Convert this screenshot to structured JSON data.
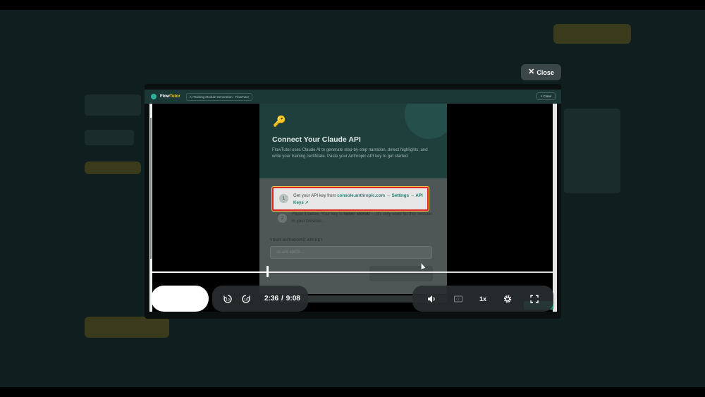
{
  "modal": {
    "close_label": "Close"
  },
  "app": {
    "name_prefix": "Flow",
    "name_suffix": "Tutor",
    "chip": "AI Training Module Generation · FlowTutor",
    "close_label": "× Close"
  },
  "dialog": {
    "title": "Connect Your Claude API",
    "description": "FlowTutor uses Claude AI to generate step-by-step narration, detect highlights, and write your training certificate. Paste your Anthropic API key to get started.",
    "step1": {
      "number": "1",
      "text": "Get your API key from ",
      "link": "console.anthropic.com → Settings → API Keys ↗"
    },
    "step2": {
      "number": "2",
      "text_before": "Paste it below. Your key is ",
      "text_bold": "never stored",
      "text_after": " — it's only used for this session in your browser."
    },
    "field_label": "YOUR ANTHROPIC API KEY",
    "field_placeholder": "sk-ant-api03-..."
  },
  "player": {
    "current_time": "2:36",
    "total_time": "9:08",
    "progress": 0.29,
    "speed": "1x",
    "icons": [
      "rewind-10-icon",
      "forward-10-icon",
      "volume-icon",
      "captions-icon",
      "settings-icon",
      "fullscreen-icon"
    ]
  }
}
